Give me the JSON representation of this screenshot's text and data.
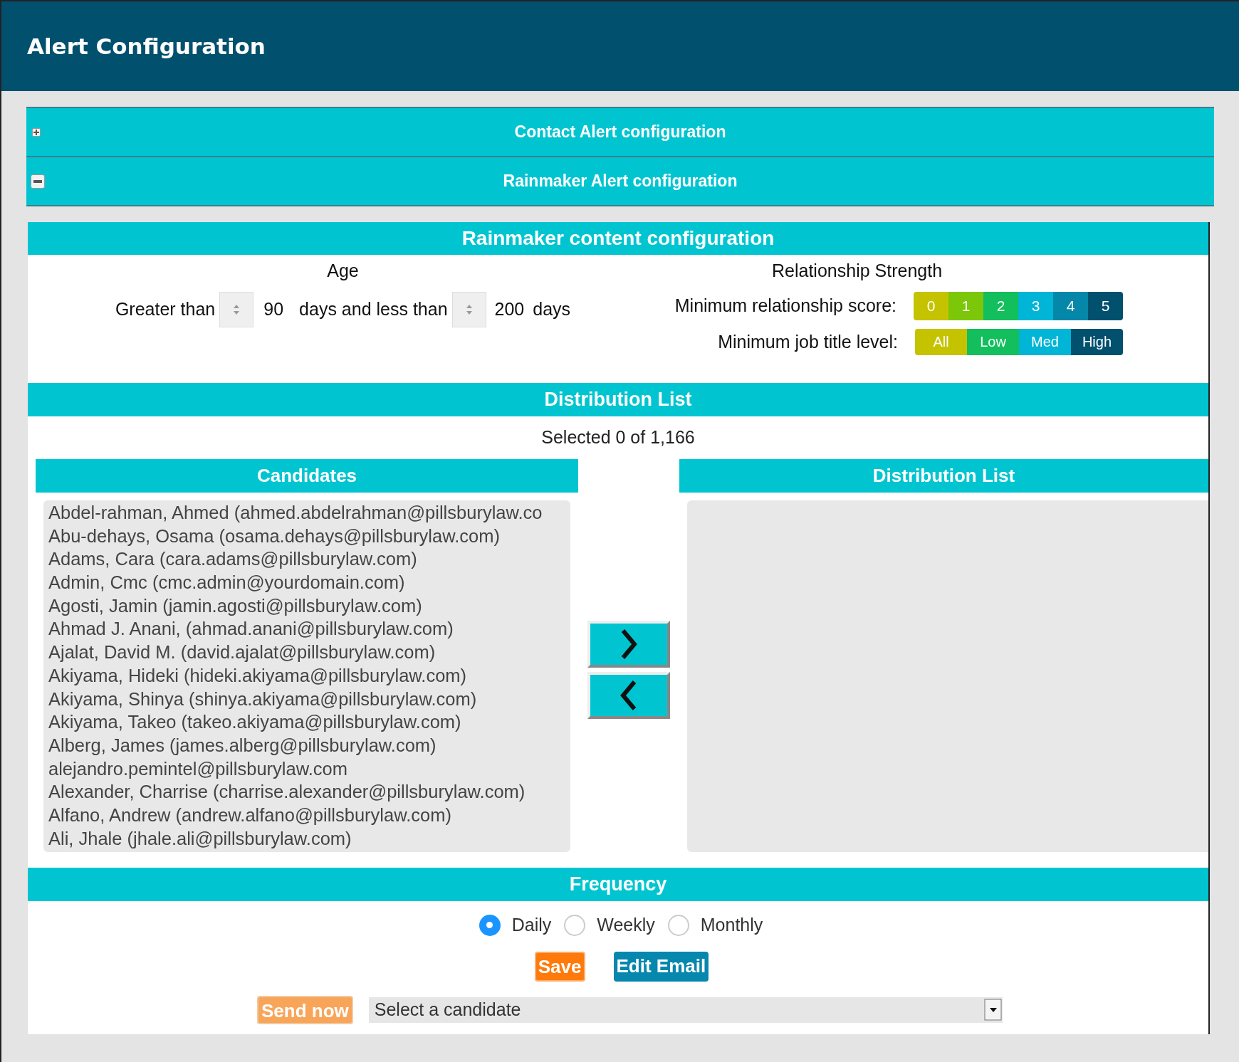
{
  "window": {
    "title": "Alert Configuration"
  },
  "accordion": [
    {
      "label": "Contact Alert configuration",
      "expanded": false
    },
    {
      "label": "Rainmaker Alert configuration",
      "expanded": true
    }
  ],
  "content_title": "Rainmaker content configuration",
  "age": {
    "heading": "Age",
    "prefix": "Greater than",
    "min": "90",
    "middle": "days and less than",
    "max": "200",
    "suffix": "days"
  },
  "relationship": {
    "heading": "Relationship Strength",
    "score_label": "Minimum relationship score:",
    "scores": [
      {
        "label": "0",
        "color": "#c5c300"
      },
      {
        "label": "1",
        "color": "#7cc70a"
      },
      {
        "label": "2",
        "color": "#12bf5c"
      },
      {
        "label": "3",
        "color": "#00b5d5"
      },
      {
        "label": "4",
        "color": "#0487a8"
      },
      {
        "label": "5",
        "color": "#01506e"
      }
    ],
    "level_label": "Minimum job title level:",
    "levels": [
      {
        "label": "All",
        "color": "#c5c300"
      },
      {
        "label": "Low",
        "color": "#12bf5c"
      },
      {
        "label": "Med",
        "color": "#00b5d5"
      },
      {
        "label": "High",
        "color": "#01506e"
      }
    ]
  },
  "distribution": {
    "title": "Distribution List",
    "selected_text": "Selected 0 of 1,166",
    "candidates_title": "Candidates",
    "list_title": "Distribution List",
    "candidates": [
      "Abdel-rahman, Ahmed (ahmed.abdelrahman@pillsburylaw.co",
      "Abu-dehays, Osama (osama.dehays@pillsburylaw.com)",
      "Adams, Cara (cara.adams@pillsburylaw.com)",
      "Admin, Cmc (cmc.admin@yourdomain.com)",
      "Agosti, Jamin (jamin.agosti@pillsburylaw.com)",
      "Ahmad J. Anani, (ahmad.anani@pillsburylaw.com)",
      "Ajalat, David M. (david.ajalat@pillsburylaw.com)",
      "Akiyama, Hideki (hideki.akiyama@pillsburylaw.com)",
      "Akiyama, Shinya (shinya.akiyama@pillsburylaw.com)",
      "Akiyama, Takeo (takeo.akiyama@pillsburylaw.com)",
      "Alberg, James (james.alberg@pillsburylaw.com)",
      "alejandro.pemintel@pillsburylaw.com",
      "Alexander, Charrise (charrise.alexander@pillsburylaw.com)",
      "Alfano, Andrew (andrew.alfano@pillsburylaw.com)",
      "Ali, Jhale (jhale.ali@pillsburylaw.com)"
    ]
  },
  "frequency": {
    "title": "Frequency",
    "options": [
      {
        "label": "Daily",
        "selected": true
      },
      {
        "label": "Weekly",
        "selected": false
      },
      {
        "label": "Monthly",
        "selected": false
      }
    ]
  },
  "buttons": [
    {
      "label": "Save",
      "kind": "save"
    },
    {
      "label": "Edit Email",
      "kind": "edit"
    }
  ],
  "send_now": {
    "label": "Send now",
    "disabled": true
  },
  "candidate_select": {
    "value": "Select a candidate"
  }
}
